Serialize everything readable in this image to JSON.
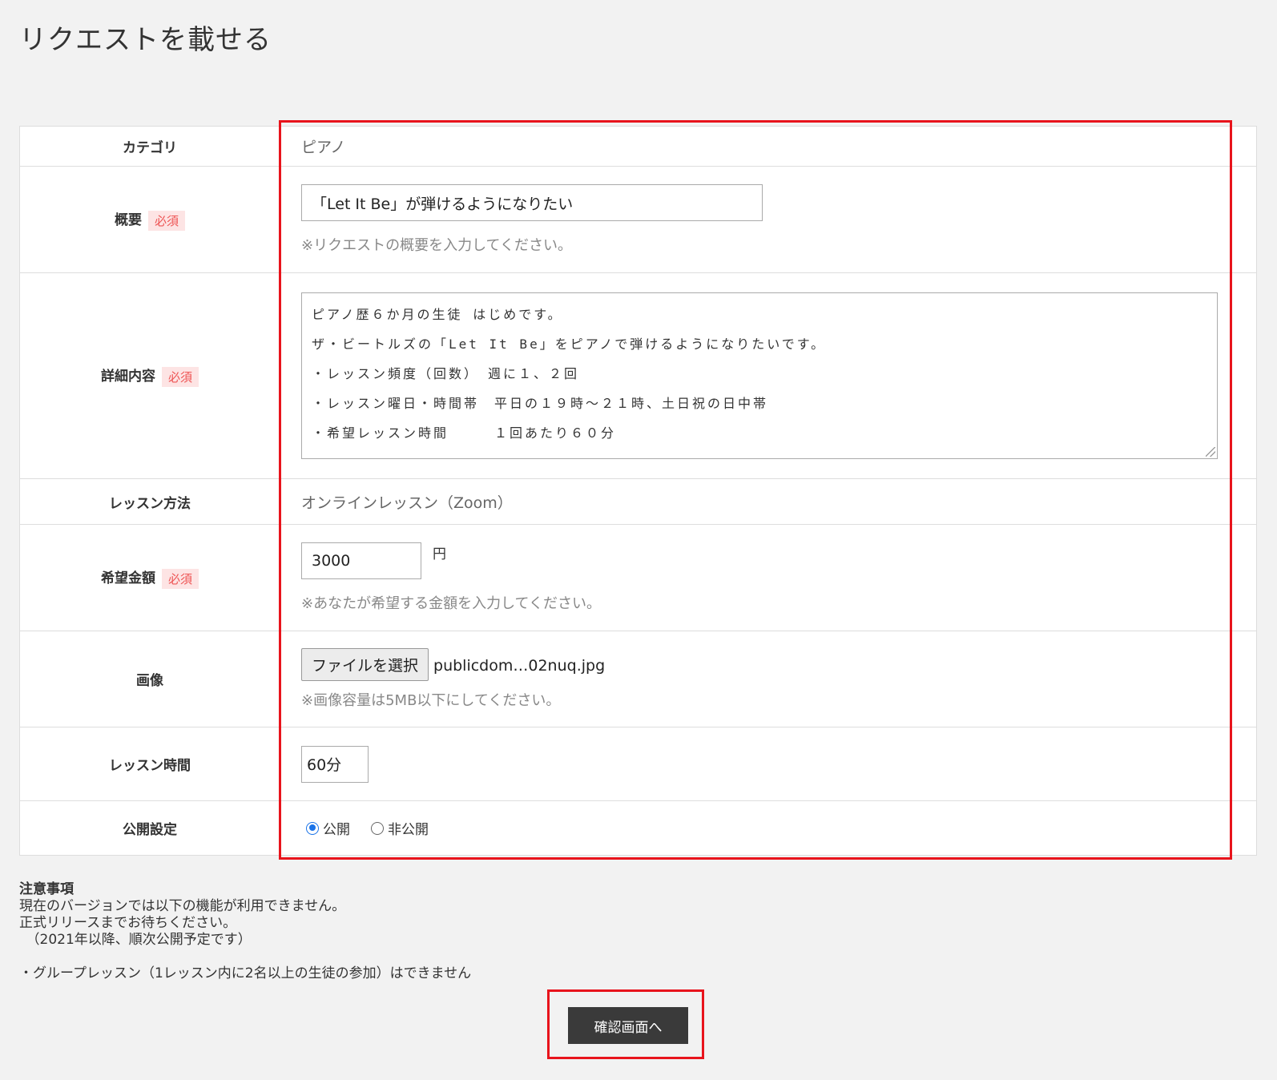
{
  "page": {
    "title": "リクエストを載せる"
  },
  "form": {
    "required_badge": "必須",
    "category": {
      "label": "カテゴリ",
      "value": "ピアノ"
    },
    "summary": {
      "label": "概要",
      "value": "「Let It Be」が弾けるようになりたい",
      "hint": "※リクエストの概要を入力してください。"
    },
    "details": {
      "label": "詳細内容",
      "lines": [
        "ピアノ歴６か月の生徒 はじめです。",
        "ザ・ビートルズの「Let It Be」をピアノで弾けるようになりたいです。",
        "・レッスン頻度（回数）　週に１、２回",
        "・レッスン曜日・時間帯　平日の１９時～２１時、土日祝の日中帯",
        "・希望レッスン時間　　　１回あたり６０分"
      ]
    },
    "method": {
      "label": "レッスン方法",
      "value": "オンラインレッスン（Zoom）"
    },
    "price": {
      "label": "希望金額",
      "value": "3000",
      "unit": "円",
      "hint": "※あなたが希望する金額を入力してください。"
    },
    "image": {
      "label": "画像",
      "button": "ファイルを選択",
      "filename": "publicdom…02nuq.jpg",
      "hint": "※画像容量は5MB以下にしてください。"
    },
    "duration": {
      "label": "レッスン時間",
      "value": "60分"
    },
    "visibility": {
      "label": "公開設定",
      "options": [
        "公開",
        "非公開"
      ],
      "selected": "公開"
    }
  },
  "notes": {
    "heading": "注意事項",
    "lines": [
      "現在のバージョンでは以下の機能が利用できません。",
      "正式リリースまでお待ちください。",
      "　（2021年以降、順次公開予定です）",
      "",
      "・グループレッスン（1レッスン内に2名以上の生徒の参加）はできません"
    ]
  },
  "submit": {
    "label": "確認画面へ"
  },
  "colors": {
    "highlight": "#e8141c",
    "accent": "#1a73e8",
    "button": "#3a3a3a"
  }
}
